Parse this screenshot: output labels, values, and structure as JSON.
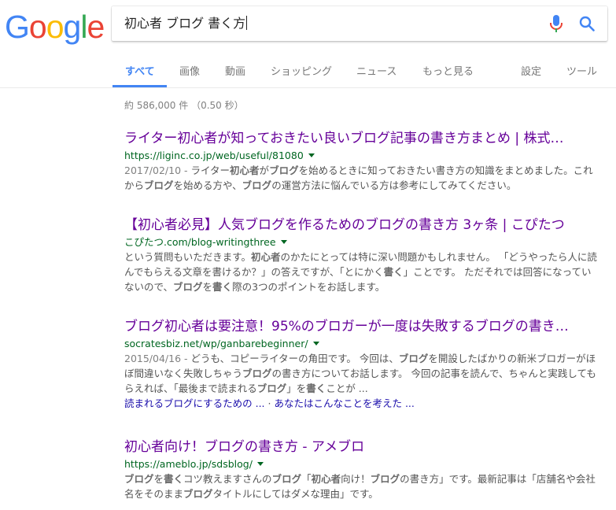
{
  "logo": {
    "text": "Google",
    "letters": [
      "G",
      "o",
      "o",
      "g",
      "l",
      "e"
    ],
    "colors": [
      "#4285f4",
      "#ea4335",
      "#fbbc05",
      "#4285f4",
      "#34a853",
      "#ea4335"
    ]
  },
  "search": {
    "query": "初心者 ブログ 書く方"
  },
  "tabs": {
    "all": "すべて",
    "images": "画像",
    "videos": "動画",
    "shopping": "ショッピング",
    "news": "ニュース",
    "more": "もっと見る",
    "settings": "設定",
    "tools": "ツール"
  },
  "stats": "約 586,000 件 （0.50 秒）",
  "results": [
    {
      "title": "ライター初心者が知っておきたい良いブログ記事の書き方まとめ | 株式…",
      "url": "https://liginc.co.jp/web/useful/81080",
      "date": "2017/02/10 - ",
      "snippet_parts": [
        "ライター",
        "初心者",
        "が",
        "ブログ",
        "を始めるときに知っておきたい書き方の知識をまとめました。これから",
        "ブログ",
        "を始める方や、",
        "ブログ",
        "の運営方法に悩んでいる方は参考にしてみてください。"
      ]
    },
    {
      "title": "【初心者必見】人気ブログを作るためのブログの書き方 3ヶ条 | こぴたつ",
      "url": "こぴたつ.com/blog-writingthree",
      "snippet_parts": [
        "という質問もいただきます。",
        "初心者",
        "のかたにとっては特に深い問題かもしれません。 「どうやったら人に読んでもらえる文章を書けるか？」の答えですが、「とにかく",
        "書く",
        "」ことです。 ただそれでは回答になっていないので、",
        "ブログ",
        "を",
        "書く",
        "際の3つのポイントをお話します。"
      ]
    },
    {
      "title": "ブログ初心者は要注意！95%のブロガーが一度は失敗するブログの書き…",
      "url": "socratesbiz.net/wp/ganbarebeginner/",
      "date": "2015/04/16 - ",
      "snippet_parts": [
        "どうも、コピーライターの角田です。 今回は、",
        "ブログ",
        "を開設したばかりの新米ブロガーがほぼ間違いなく失敗しちゃう",
        "ブログ",
        "の書き方についてお話します。 今回の記事を読んで、ちゃんと実践してもらえれば、「最後まで読まれる",
        "ブログ",
        "」を",
        "書く",
        "ことが ..."
      ],
      "sitelinks": [
        "読まれるブログにするための ...",
        "あなたはこんなことを考えた ..."
      ],
      "sitelink_sep": "·"
    },
    {
      "title": "初心者向け！ブログの書き方 - アメブロ",
      "url": "https://ameblo.jp/sdsblog/",
      "snippet_parts": [
        "ブログ",
        "を",
        "書く",
        "コツ教えますさんの",
        "ブログ",
        "「",
        "初心者",
        "向け！",
        "ブログ",
        "の書き方」です。最新記事は「店舗名や会社名をそのまま",
        "ブログ",
        "タイトルにしてはダメな理由」です。"
      ]
    }
  ]
}
